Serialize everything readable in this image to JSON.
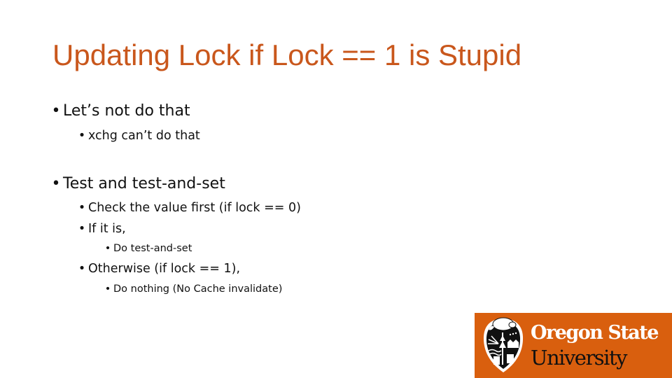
{
  "slide": {
    "title": "Updating Lock if Lock == 1 is Stupid",
    "bullet_glyph": "•",
    "bullets": [
      {
        "level": 1,
        "text": "Let’s not do that"
      },
      {
        "level": 2,
        "text": "xchg can’t do that"
      },
      {
        "level": 1,
        "text": "Test and test-and-set"
      },
      {
        "level": 2,
        "text": "Check the value first (if lock == 0)"
      },
      {
        "level": 2,
        "text": "If it is,"
      },
      {
        "level": 3,
        "text": "Do test-and-set"
      },
      {
        "level": 2,
        "text": "Otherwise (if lock == 1),"
      },
      {
        "level": 3,
        "text": "Do nothing (No Cache invalidate)"
      }
    ]
  },
  "logo": {
    "line1": "Oregon State",
    "line2": "University",
    "icon": "beaver-shield-icon",
    "background_color": "#d95f0e"
  },
  "colors": {
    "title": "#c9571c",
    "body_text": "#111111",
    "background": "#ffffff"
  }
}
